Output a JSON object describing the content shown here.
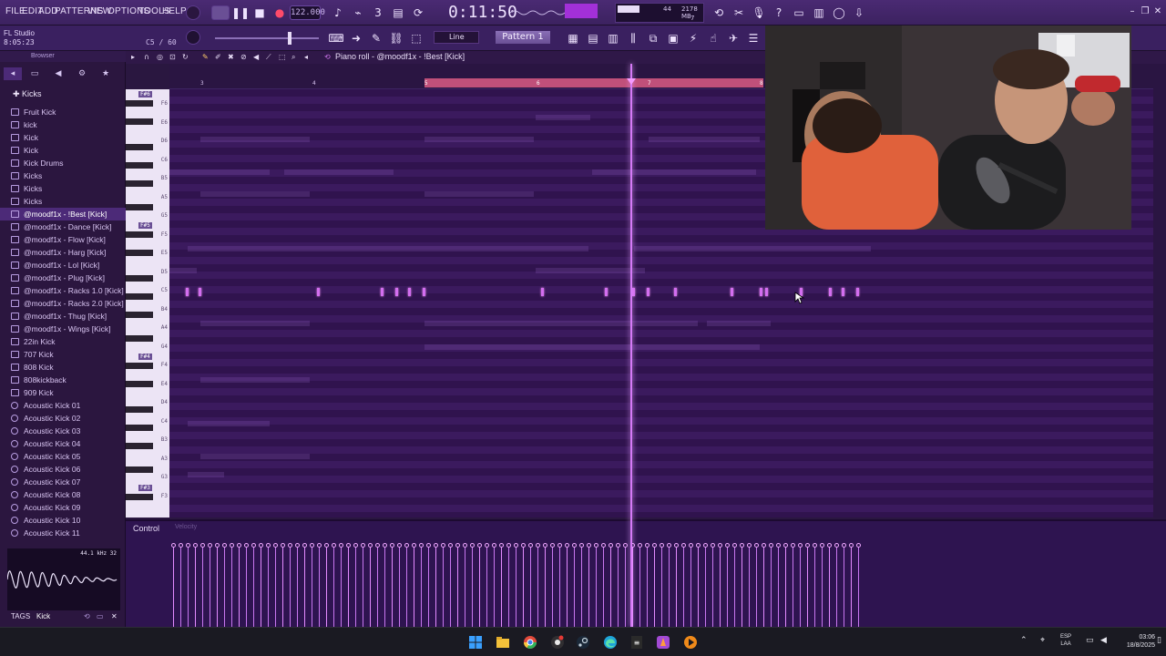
{
  "menu": [
    "FILE",
    "EDIT",
    "ADD",
    "PATTERNS",
    "VIEW",
    "OPTIONS",
    "TOOLS",
    "HELP"
  ],
  "transport": {
    "tempo": "122.000",
    "song_time": "0:11:50",
    "ram_mb": "2178 MB",
    "ram_voices": "44",
    "ram_cpu": "7"
  },
  "studio": {
    "name": "FL Studio",
    "elapsed": "8:05:23",
    "voices": "C5 / 60"
  },
  "toolbar2": {
    "snap": "Line",
    "pattern": "Pattern 1"
  },
  "browser": {
    "title": "Browser",
    "folder": "Kicks",
    "items": [
      {
        "label": "Fruit Kick",
        "type": "folder"
      },
      {
        "label": "kick",
        "type": "folder"
      },
      {
        "label": "Kick",
        "type": "folder"
      },
      {
        "label": "Kick",
        "type": "folder"
      },
      {
        "label": "Kick Drums",
        "type": "folder"
      },
      {
        "label": "Kicks",
        "type": "folder"
      },
      {
        "label": "Kicks",
        "type": "folder"
      },
      {
        "label": "Kicks",
        "type": "folder"
      },
      {
        "label": "@moodf1x - !Best [Kick]",
        "type": "folder",
        "selected": true
      },
      {
        "label": "@moodf1x - Dance [Kick]",
        "type": "folder"
      },
      {
        "label": "@moodf1x - Flow [Kick]",
        "type": "folder"
      },
      {
        "label": "@moodf1x - Harg [Kick]",
        "type": "folder"
      },
      {
        "label": "@moodf1x - Lol [Kick]",
        "type": "folder"
      },
      {
        "label": "@moodf1x - Plug [Kick]",
        "type": "folder"
      },
      {
        "label": "@moodf1x - Racks 1.0 [Kick]",
        "type": "folder"
      },
      {
        "label": "@moodf1x - Racks 2.0 [Kick]",
        "type": "folder"
      },
      {
        "label": "@moodf1x - Thug [Kick]",
        "type": "folder"
      },
      {
        "label": "@moodf1x - Wings [Kick]",
        "type": "folder"
      },
      {
        "label": "22in Kick",
        "type": "folder"
      },
      {
        "label": "707 Kick",
        "type": "folder"
      },
      {
        "label": "808 Kick",
        "type": "folder"
      },
      {
        "label": "808kickback",
        "type": "folder"
      },
      {
        "label": "909 Kick",
        "type": "folder"
      },
      {
        "label": "Acoustic Kick 01",
        "type": "sample"
      },
      {
        "label": "Acoustic Kick 02",
        "type": "sample"
      },
      {
        "label": "Acoustic Kick 03",
        "type": "sample"
      },
      {
        "label": "Acoustic Kick 04",
        "type": "sample"
      },
      {
        "label": "Acoustic Kick 05",
        "type": "sample"
      },
      {
        "label": "Acoustic Kick 06",
        "type": "sample"
      },
      {
        "label": "Acoustic Kick 07",
        "type": "sample"
      },
      {
        "label": "Acoustic Kick 08",
        "type": "sample"
      },
      {
        "label": "Acoustic Kick 09",
        "type": "sample"
      },
      {
        "label": "Acoustic Kick 10",
        "type": "sample"
      },
      {
        "label": "Acoustic Kick 11",
        "type": "sample"
      }
    ],
    "waveform_info": "44.1 kHz 32",
    "tags_label": "TAGS",
    "tag_value": "Kick"
  },
  "piano_roll": {
    "title": "Piano roll - @moodf1x - !Best [Kick]",
    "ruler": [
      "3",
      "4",
      "5",
      "6",
      "7",
      "8"
    ],
    "key_labels": [
      "F6",
      "E6",
      "D6",
      "C6",
      "B5",
      "A5",
      "G5",
      "F5",
      "E5",
      "D5",
      "C5",
      "B4",
      "A4",
      "G4",
      "F4",
      "E4",
      "D4",
      "C4",
      "B3",
      "A3",
      "G3",
      "F3"
    ],
    "octave_marks": [
      "F#6",
      "F#5",
      "F#4",
      "F#3"
    ],
    "control_label": "Control",
    "control_target": "Velocity"
  },
  "system_tray": {
    "language": "ESP",
    "language_sub": "LAA",
    "time": "03:06",
    "date": "18/8/2025"
  },
  "icons": {
    "taskbar": [
      "windows-start-icon",
      "file-explorer-icon",
      "chrome-icon",
      "obs-icon",
      "steam-icon",
      "edge-icon",
      "epic-games-icon",
      "fl-studio-icon",
      "media-player-icon"
    ]
  },
  "colors": {
    "accent": "#d36ef0",
    "grid_bg": "#3b1a5e",
    "loop_bar": "#c0507a",
    "cpu_meter": "#a230d8"
  }
}
